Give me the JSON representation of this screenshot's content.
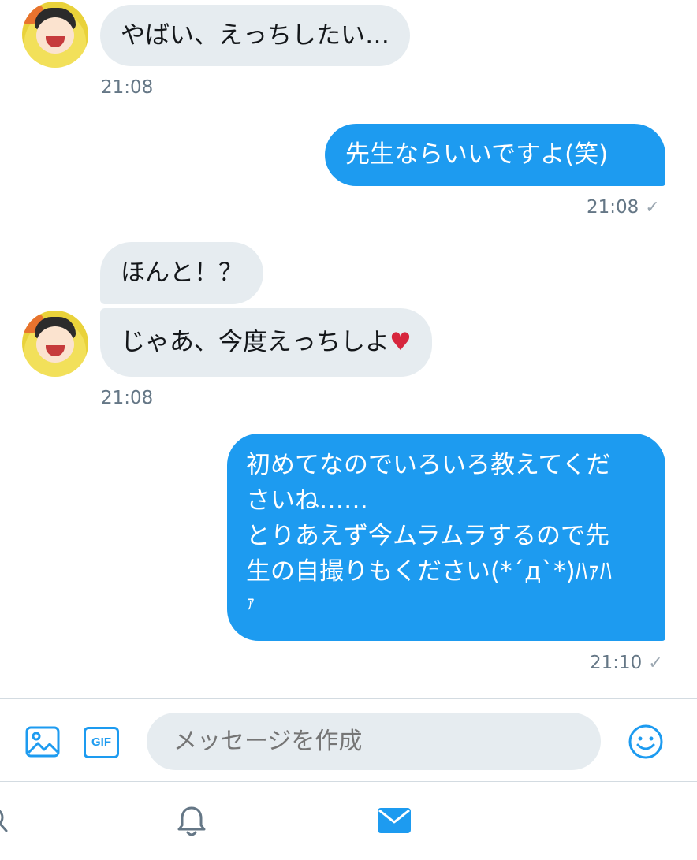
{
  "messages": [
    {
      "text": "やばい、えっちしたい…",
      "time": "21:08"
    },
    {
      "text": "先生ならいいですよ(笑)",
      "time": "21:08"
    },
    {
      "text": "ほんと！？"
    },
    {
      "text": "じゃあ、今度えっちしよ",
      "emoji": "♥",
      "time": "21:08"
    },
    {
      "lines": [
        "初めてなのでいろいろ教えてくだ",
        "さいね……",
        "とりあえず今ムラムラするので先",
        "生の自撮りもください(*´д`*)ﾊｧﾊ",
        "ｧ"
      ],
      "time": "21:10"
    }
  ],
  "read_check": "✓",
  "composer": {
    "placeholder": "メッセージを作成",
    "gif_label": "GIF"
  },
  "colors": {
    "accent": "#1d9bf0",
    "incoming": "#e6ecf0",
    "muted": "#657786"
  },
  "icons": [
    "image-icon",
    "gif-icon",
    "emoji-icon",
    "search-icon",
    "bell-icon",
    "mail-icon"
  ]
}
